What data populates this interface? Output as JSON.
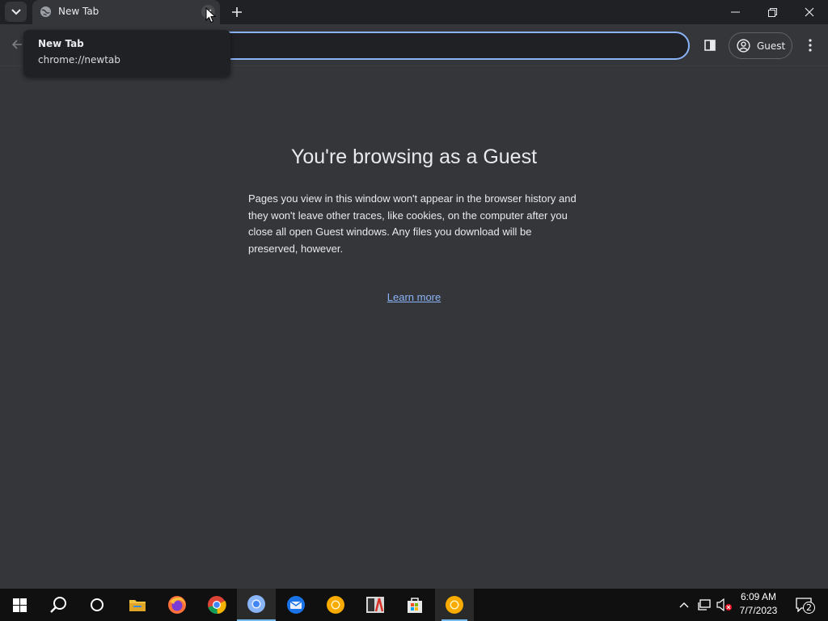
{
  "browser": {
    "tab": {
      "title": "New Tab"
    },
    "hovercard": {
      "title": "New Tab",
      "url": "chrome://newtab"
    },
    "profile_label": "Guest"
  },
  "page": {
    "title": "You're browsing as a Guest",
    "body": "Pages you view in this window won't appear in the browser history and they won't leave other traces, like cookies, on the computer after you close all open Guest windows. Any files you download will be preserved, however.",
    "learn_more": "Learn more"
  },
  "taskbar": {
    "apps": [
      "start-icon",
      "search-icon",
      "cortana-icon",
      "file-explorer-icon",
      "firefox-icon",
      "chrome-icon",
      "chrome-icon",
      "thunderbird-icon",
      "chrome-canary-icon",
      "typora-icon",
      "store-icon",
      "chrome-canary-icon"
    ],
    "clock": {
      "time": "6:09 AM",
      "date": "7/7/2023"
    },
    "notification_count": "2"
  },
  "colors": {
    "accent": "#8ab4f8",
    "background": "#35363a",
    "taskbar": "#101010"
  }
}
